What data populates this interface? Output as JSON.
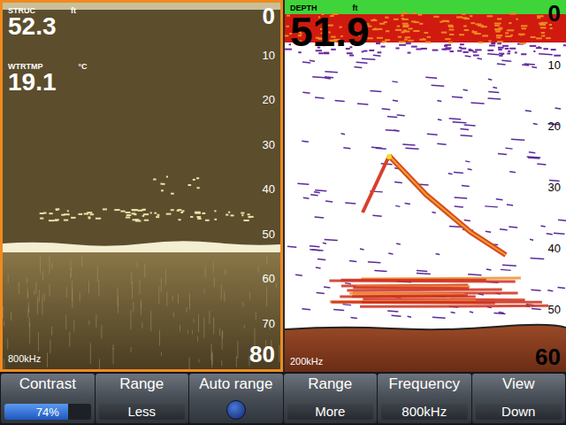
{
  "panels": [
    {
      "kind": "structure",
      "selected": true,
      "readings": [
        {
          "label": "STRUC",
          "unit": "ft",
          "value": "52.3"
        },
        {
          "label": "WTRTMP",
          "unit": "°C",
          "value": "19.1"
        }
      ],
      "scale": [
        "0",
        "10",
        "20",
        "30",
        "40",
        "50",
        "60",
        "70",
        "80"
      ],
      "frequency": "800kHz"
    },
    {
      "kind": "sonar",
      "selected": false,
      "readings": [
        {
          "label": "DEPTH",
          "unit": "ft",
          "value": "51.9"
        }
      ],
      "scale": [
        "0",
        "10",
        "20",
        "30",
        "40",
        "50",
        "60"
      ],
      "frequency": "200kHz"
    }
  ],
  "toolbar": [
    {
      "kind": "slider",
      "label": "Contrast",
      "level": 0.74,
      "reading": "74%"
    },
    {
      "kind": "text",
      "label": "Range",
      "value": "Less"
    },
    {
      "kind": "toggle",
      "label": "Auto range",
      "on": false
    },
    {
      "kind": "text",
      "label": "Range",
      "value": "More"
    },
    {
      "kind": "text",
      "label": "Frequency",
      "value": "800kHz"
    },
    {
      "kind": "text",
      "label": "View",
      "value": "Down"
    }
  ]
}
